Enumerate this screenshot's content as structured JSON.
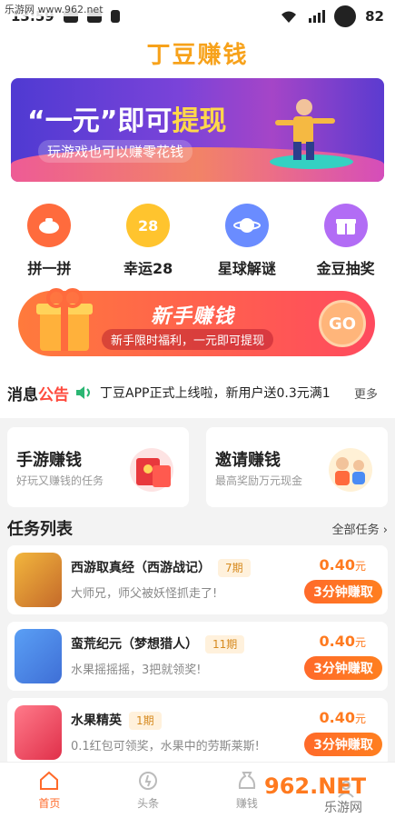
{
  "status_bar": {
    "watermark": "乐游网 www.962.net",
    "time": "13:59",
    "battery_level": "82"
  },
  "header": {
    "title": "丁豆赚钱"
  },
  "banner": {
    "headline_prefix": "“一元”即可",
    "headline_highlight": "提现",
    "subtitle": "玩游戏也可以赚零花钱"
  },
  "quick_nav": [
    {
      "label": "拼一拼",
      "icon": "piggy-bank-icon",
      "color": "#ff6b3d"
    },
    {
      "label": "幸运28",
      "icon": "lucky-28-icon",
      "icon_text": "28",
      "color": "#ffc42e"
    },
    {
      "label": "星球解谜",
      "icon": "planet-icon",
      "color": "#6a8cff"
    },
    {
      "label": "金豆抽奖",
      "icon": "gift-icon",
      "color": "#b26cf5"
    }
  ],
  "newbie_banner": {
    "title": "新手赚钱",
    "subtitle": "新手限时福利，一元即可提现",
    "go_label": "GO"
  },
  "notice": {
    "label_black": "消息",
    "label_red": "公告",
    "text": "丁豆APP正式上线啦，新用户送0.3元满1",
    "more": "更多"
  },
  "earn_cards": [
    {
      "title": "手游赚钱",
      "subtitle": "好玩又赚钱的任务",
      "art": "red-envelope-icon"
    },
    {
      "title": "邀请赚钱",
      "subtitle": "最高奖励万元现金",
      "art": "people-icon"
    }
  ],
  "tasks_section": {
    "title": "任务列表",
    "all_label": "全部任务 ›"
  },
  "tasks": [
    {
      "name": "西游取真经（西游战记）",
      "period": "7期",
      "desc": "大师兄，师父被妖怪抓走了!",
      "reward": "0.40",
      "unit": "元",
      "button": "3分钟赚取",
      "thumb_color": "#c56a2a"
    },
    {
      "name": "蛮荒纪元（梦想猎人）",
      "period": "11期",
      "desc": "水果摇摇摇，3把就领奖!",
      "reward": "0.40",
      "unit": "元",
      "button": "3分钟赚取",
      "thumb_color": "#3f6fd6"
    },
    {
      "name": "水果精英",
      "period": "1期",
      "desc": "0.1红包可领奖，水果中的劳斯莱斯!",
      "reward": "0.40",
      "unit": "元",
      "button": "3分钟赚取",
      "thumb_color": "#e0304a"
    }
  ],
  "bottom_nav": [
    {
      "label": "首页",
      "icon": "home-icon",
      "active": true
    },
    {
      "label": "头条",
      "icon": "news-icon",
      "active": false
    },
    {
      "label": "赚钱",
      "icon": "money-bag-icon",
      "active": false
    },
    {
      "label": "",
      "icon": "profile-icon",
      "active": false
    }
  ],
  "bottom_watermark": {
    "brand": "962.NET",
    "sub": "乐游网"
  },
  "colors": {
    "accent": "#ff6a2a",
    "title": "#f7a21b",
    "notice_red": "#ff4a3d"
  }
}
